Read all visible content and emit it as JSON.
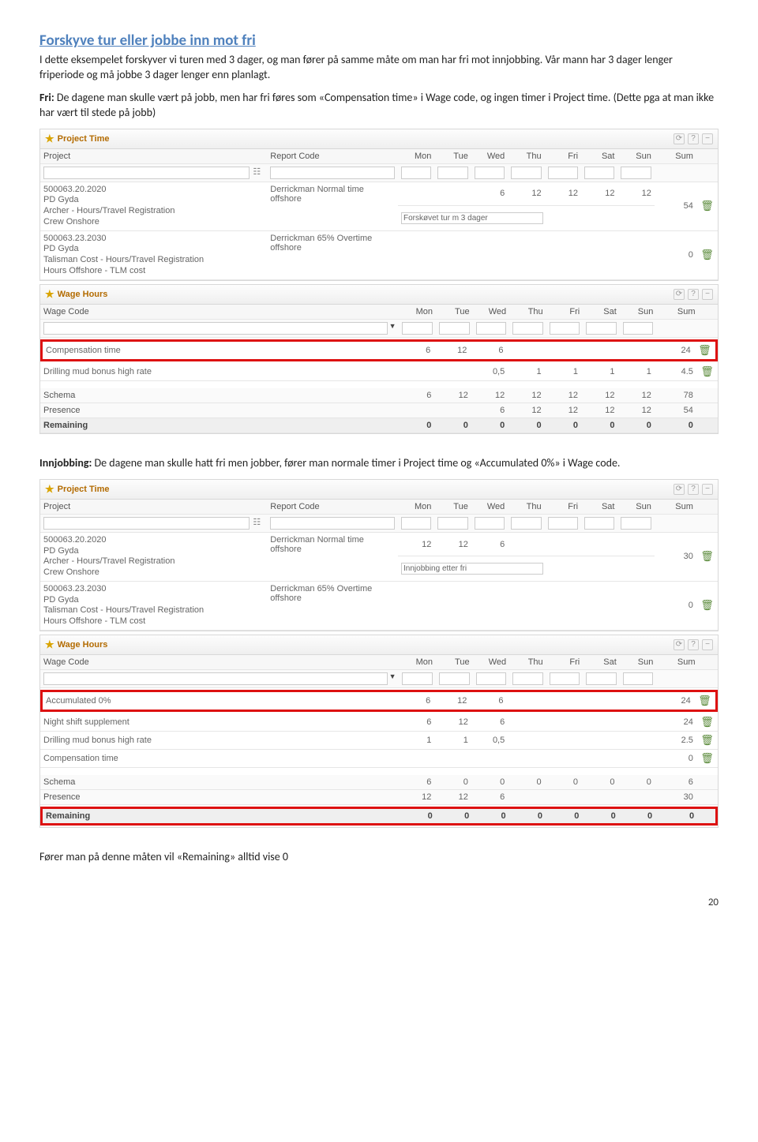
{
  "heading": "Forskyve tur eller jobbe inn mot fri",
  "intro1": "I dette eksempelet  forskyver vi turen med 3 dager, og man fører på samme måte om man har fri mot innjobbing. Vår mann har 3 dager lenger friperiode og må jobbe 3 dager lenger enn planlagt.",
  "intro2_prefix": "Fri:",
  "intro2": " De dagene man skulle vært på jobb, men har fri føres som  «Compensation time» i Wage code, og ingen timer i Project time. (Dette pga at man ikke har vært til stede på jobb)",
  "panels": {
    "projectTime": "Project Time",
    "wageHours": "Wage Hours"
  },
  "cols": {
    "project": "Project",
    "reportCode": "Report Code",
    "wageCode": "Wage Code",
    "mon": "Mon",
    "tue": "Tue",
    "wed": "Wed",
    "thu": "Thu",
    "fri": "Fri",
    "sat": "Sat",
    "sun": "Sun",
    "sum": "Sum"
  },
  "pt1": {
    "rows": [
      {
        "project": "500063.20.2020\nPD Gyda\nArcher - Hours/Travel Registration\nCrew Onshore",
        "report": "Derrickman Normal time offshore",
        "vals": [
          "",
          "",
          "6",
          "12",
          "12",
          "12",
          "12"
        ],
        "sum": "54",
        "note": "Forskøvet tur m 3 dager"
      },
      {
        "project": "500063.23.2030\nPD Gyda\nTalisman Cost - Hours/Travel Registration\nHours Offshore - TLM cost",
        "report": "Derrickman 65% Overtime offshore",
        "vals": [
          "",
          "",
          "",
          "",
          "",
          "",
          ""
        ],
        "sum": "0"
      }
    ]
  },
  "wh1": {
    "comp": {
      "label": "Compensation time",
      "vals": [
        "6",
        "12",
        "6",
        "",
        "",
        "",
        ""
      ],
      "sum": "24"
    },
    "drill": {
      "label": "Drilling mud bonus high rate",
      "vals": [
        "",
        "",
        "0,5",
        "1",
        "1",
        "1",
        "1"
      ],
      "sum": "4.5"
    },
    "schema": {
      "label": "Schema",
      "vals": [
        "6",
        "12",
        "12",
        "12",
        "12",
        "12",
        "12"
      ],
      "sum": "78"
    },
    "presence": {
      "label": "Presence",
      "vals": [
        "",
        "",
        "6",
        "12",
        "12",
        "12",
        "12"
      ],
      "sum": "54"
    },
    "remaining": {
      "label": "Remaining",
      "vals": [
        "0",
        "0",
        "0",
        "0",
        "0",
        "0",
        "0"
      ],
      "sum": "0"
    }
  },
  "mid_prefix": "Innjobbing:",
  "mid": " De dagene man skulle hatt fri men jobber, fører man normale timer i Project time og «Accumulated 0%» i Wage code.",
  "pt2": {
    "rows": [
      {
        "project": "500063.20.2020\nPD Gyda\nArcher - Hours/Travel Registration\nCrew Onshore",
        "report": "Derrickman Normal time offshore",
        "vals": [
          "12",
          "12",
          "6",
          "",
          "",
          "",
          ""
        ],
        "sum": "30",
        "note": "Innjobbing etter fri"
      },
      {
        "project": "500063.23.2030\nPD Gyda\nTalisman Cost - Hours/Travel Registration\nHours Offshore - TLM cost",
        "report": "Derrickman 65% Overtime offshore",
        "vals": [
          "",
          "",
          "",
          "",
          "",
          "",
          ""
        ],
        "sum": "0"
      }
    ]
  },
  "wh2": {
    "acc": {
      "label": "Accumulated 0%",
      "vals": [
        "6",
        "12",
        "6",
        "",
        "",
        "",
        ""
      ],
      "sum": "24"
    },
    "night": {
      "label": "Night shift supplement",
      "vals": [
        "6",
        "12",
        "6",
        "",
        "",
        "",
        ""
      ],
      "sum": "24"
    },
    "drill": {
      "label": "Drilling mud bonus high rate",
      "vals": [
        "1",
        "1",
        "0,5",
        "",
        "",
        "",
        ""
      ],
      "sum": "2.5"
    },
    "comp": {
      "label": "Compensation time",
      "vals": [
        "",
        "",
        "",
        "",
        "",
        "",
        ""
      ],
      "sum": "0"
    },
    "schema": {
      "label": "Schema",
      "vals": [
        "6",
        "0",
        "0",
        "0",
        "0",
        "0",
        "0"
      ],
      "sum": "6"
    },
    "presence": {
      "label": "Presence",
      "vals": [
        "12",
        "12",
        "6",
        "",
        "",
        "",
        ""
      ],
      "sum": "30"
    },
    "remaining": {
      "label": "Remaining",
      "vals": [
        "0",
        "0",
        "0",
        "0",
        "0",
        "0",
        "0"
      ],
      "sum": "0"
    }
  },
  "closing": "Fører man på denne måten vil «Remaining» alltid vise 0",
  "pagenum": "20"
}
